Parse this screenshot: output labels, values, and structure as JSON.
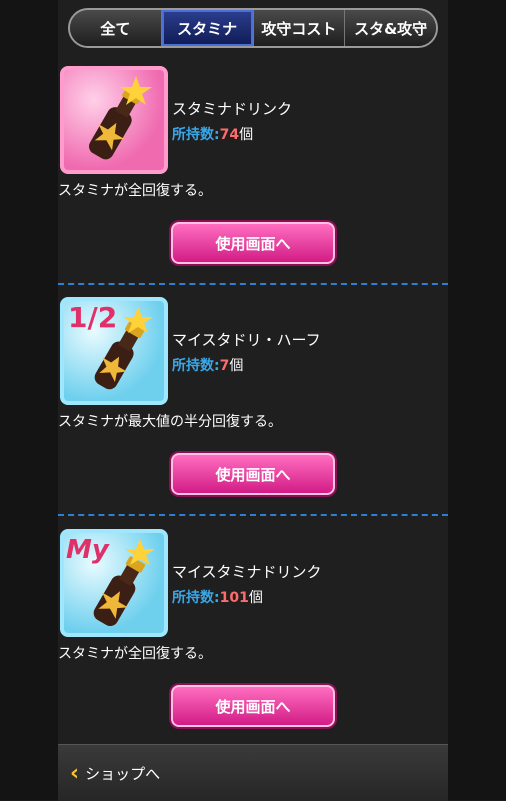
{
  "tabs": [
    {
      "label": "全て"
    },
    {
      "label": "スタミナ"
    },
    {
      "label": "攻守コスト"
    },
    {
      "label": "スタ&攻守"
    }
  ],
  "active_tab": "スタミナ",
  "items": [
    {
      "name": "スタミナドリンク",
      "count_label": "所持数:",
      "count": "74",
      "count_unit": "個",
      "description": "スタミナが全回復する。",
      "button_label": "使用画面へ",
      "icon": "stamina-drink-icon",
      "badge": "",
      "theme_color": "#f06ab0"
    },
    {
      "name": "マイスタドリ・ハーフ",
      "count_label": "所持数:",
      "count": "7",
      "count_unit": "個",
      "description": "スタミナが最大値の半分回復する。",
      "button_label": "使用画面へ",
      "icon": "half-stamina-drink-icon",
      "badge": "1/2",
      "theme_color": "#6fd0ee"
    },
    {
      "name": "マイスタミナドリンク",
      "count_label": "所持数:",
      "count": "101",
      "count_unit": "個",
      "description": "スタミナが全回復する。",
      "button_label": "使用画面へ",
      "icon": "my-stamina-drink-icon",
      "badge": "My",
      "theme_color": "#6fd0ee"
    }
  ],
  "footer": {
    "label": "ショップへ",
    "icon": "chevron-left-icon"
  },
  "colors": {
    "accent_blue": "#3aa7e8",
    "count_red": "#ff6b6b",
    "button_pink": "#d21c86",
    "tab_active": "#101a55"
  }
}
